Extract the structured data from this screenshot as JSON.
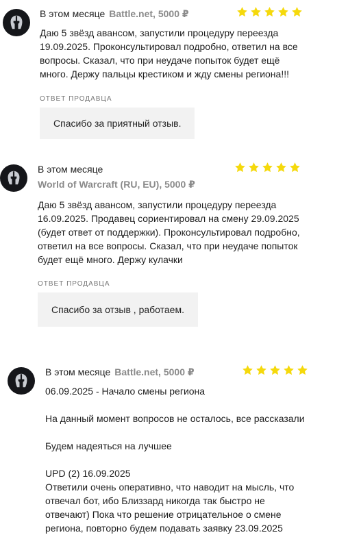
{
  "reviews": [
    {
      "date": "В этом месяце",
      "product": "Battle.net, 5000 ₽",
      "rating": 5,
      "text": "Даю 5 звёзд авансом, запустили процедуру переезда\n19.09.2025. Проконсультировал подробно, ответил на все\nвопросы. Сказал, что при неудаче попыток будет ещё\nмного. Держу пальцы крестиком и жду смены региона!!!",
      "seller_label": "ОТВЕТ ПРОДАВЦА",
      "seller_reply": "Спасибо за приятный отзыв."
    },
    {
      "date": "В этом месяце",
      "product": "World of Warcraft (RU, EU), 5000 ₽",
      "rating": 5,
      "text": "Даю 5 звёзд авансом, запустили процедуру переезда\n16.09.2025. Продавец сориентировал на смену 29.09.2025\n(будет ответ от поддержки). Проконсультировал подробно,\nответил на все вопросы. Сказал, что при неудаче попыток\nбудет ещё много. Держу кулачки",
      "seller_label": "ОТВЕТ ПРОДАВЦА",
      "seller_reply": "Спасибо за отзыв , работаем."
    },
    {
      "date": "В этом месяце",
      "product": "Battle.net, 5000 ₽",
      "rating": 5,
      "text": "06.09.2025 - Начало смены региона\n\nНа данный момент вопросов не осталось, все рассказали\n\nБудем надеяться на лучшее\n\nUPD (2) 16.09.2025\nОтветили очень оперативно, что наводит на мысль, что\nотвечал бот, ибо Близзард никогда так быстро не\nотвечают) Пока что решение отрицательное о смене\nрегиона, повторно будем подавать заявку 23.09.2025"
    }
  ],
  "icons": {
    "avatar": "spartan-helmet-icon",
    "star": "star-icon"
  },
  "colors": {
    "star": "#f5d90c",
    "avatar_bg": "#15161a",
    "product": "#8a8a8a",
    "reply_bg": "#f2f2f2"
  }
}
